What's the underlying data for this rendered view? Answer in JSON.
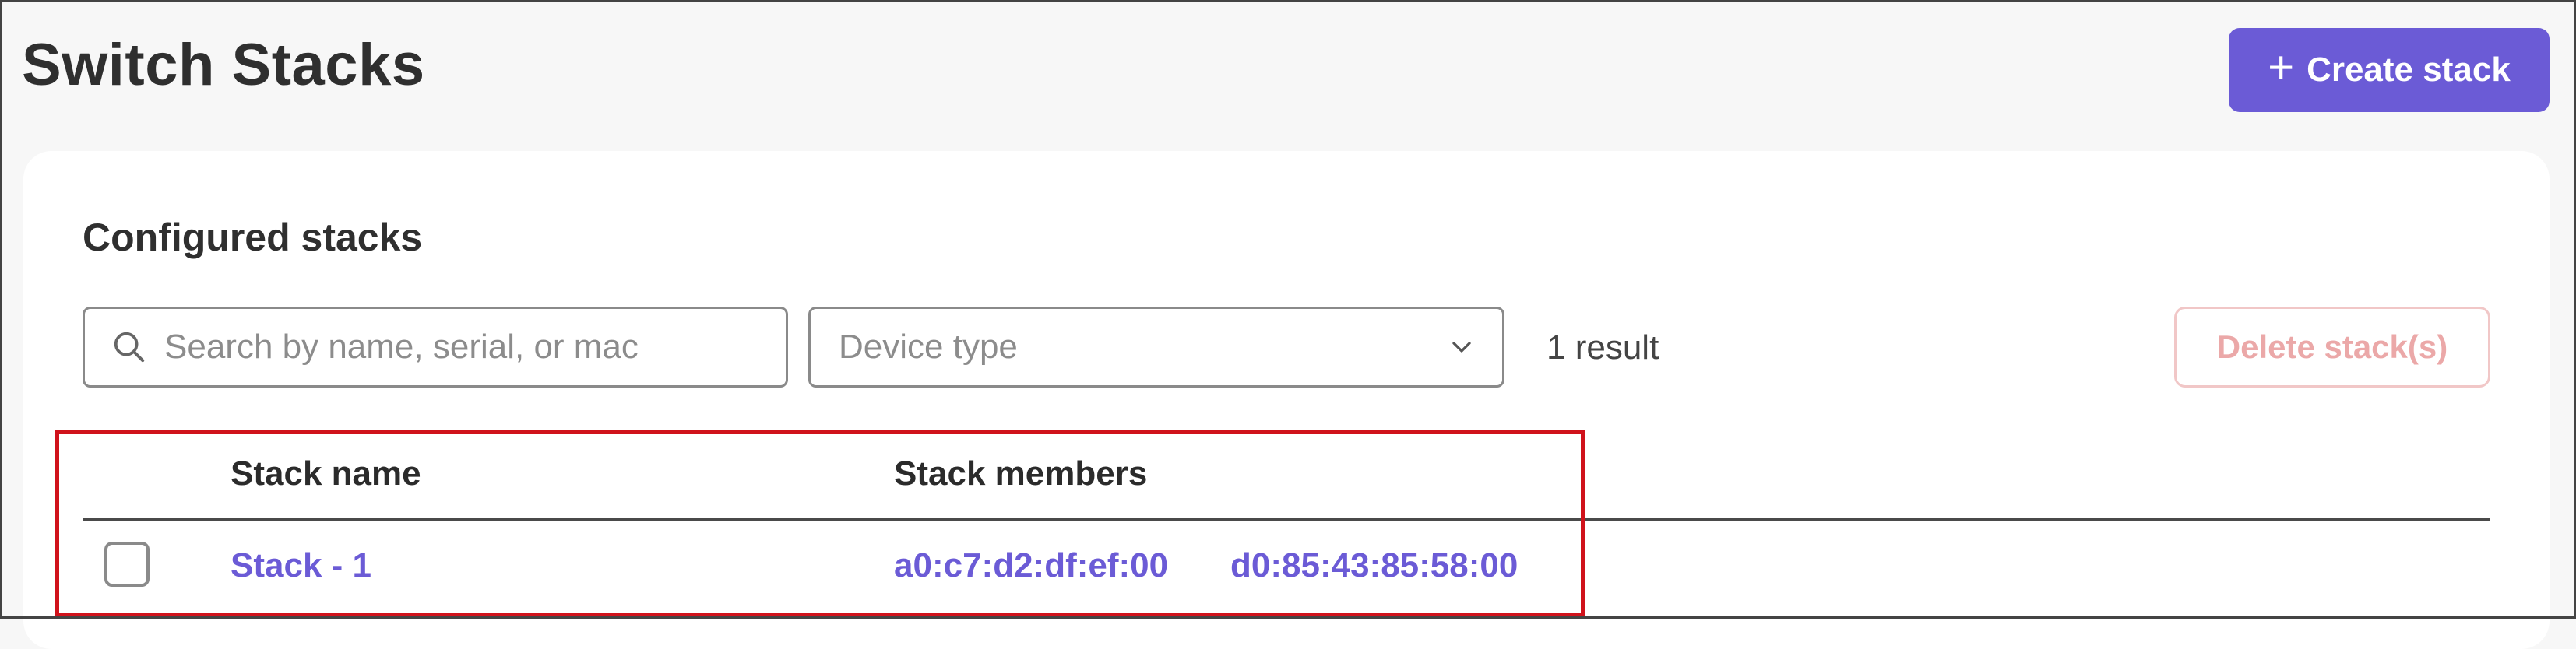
{
  "header": {
    "title": "Switch Stacks",
    "create_label": "Create stack",
    "create_icon": "plus-icon"
  },
  "card": {
    "title": "Configured stacks",
    "search": {
      "placeholder": "Search by name, serial, or mac",
      "value": "",
      "icon": "search-icon"
    },
    "device_type": {
      "placeholder": "Device type",
      "icon": "chevron-down-icon"
    },
    "result_count": "1 result",
    "delete_label": "Delete stack(s)",
    "table": {
      "columns": [
        "Stack name",
        "Stack members"
      ],
      "rows": [
        {
          "name": "Stack - 1",
          "members": [
            "a0:c7:d2:df:ef:00",
            "d0:85:43:85:58:00"
          ]
        }
      ]
    }
  },
  "colors": {
    "accent": "#6b5bd6",
    "delete_disabled": "#eba8a8",
    "highlight": "#d0121b",
    "background": "#f7f7f7"
  }
}
